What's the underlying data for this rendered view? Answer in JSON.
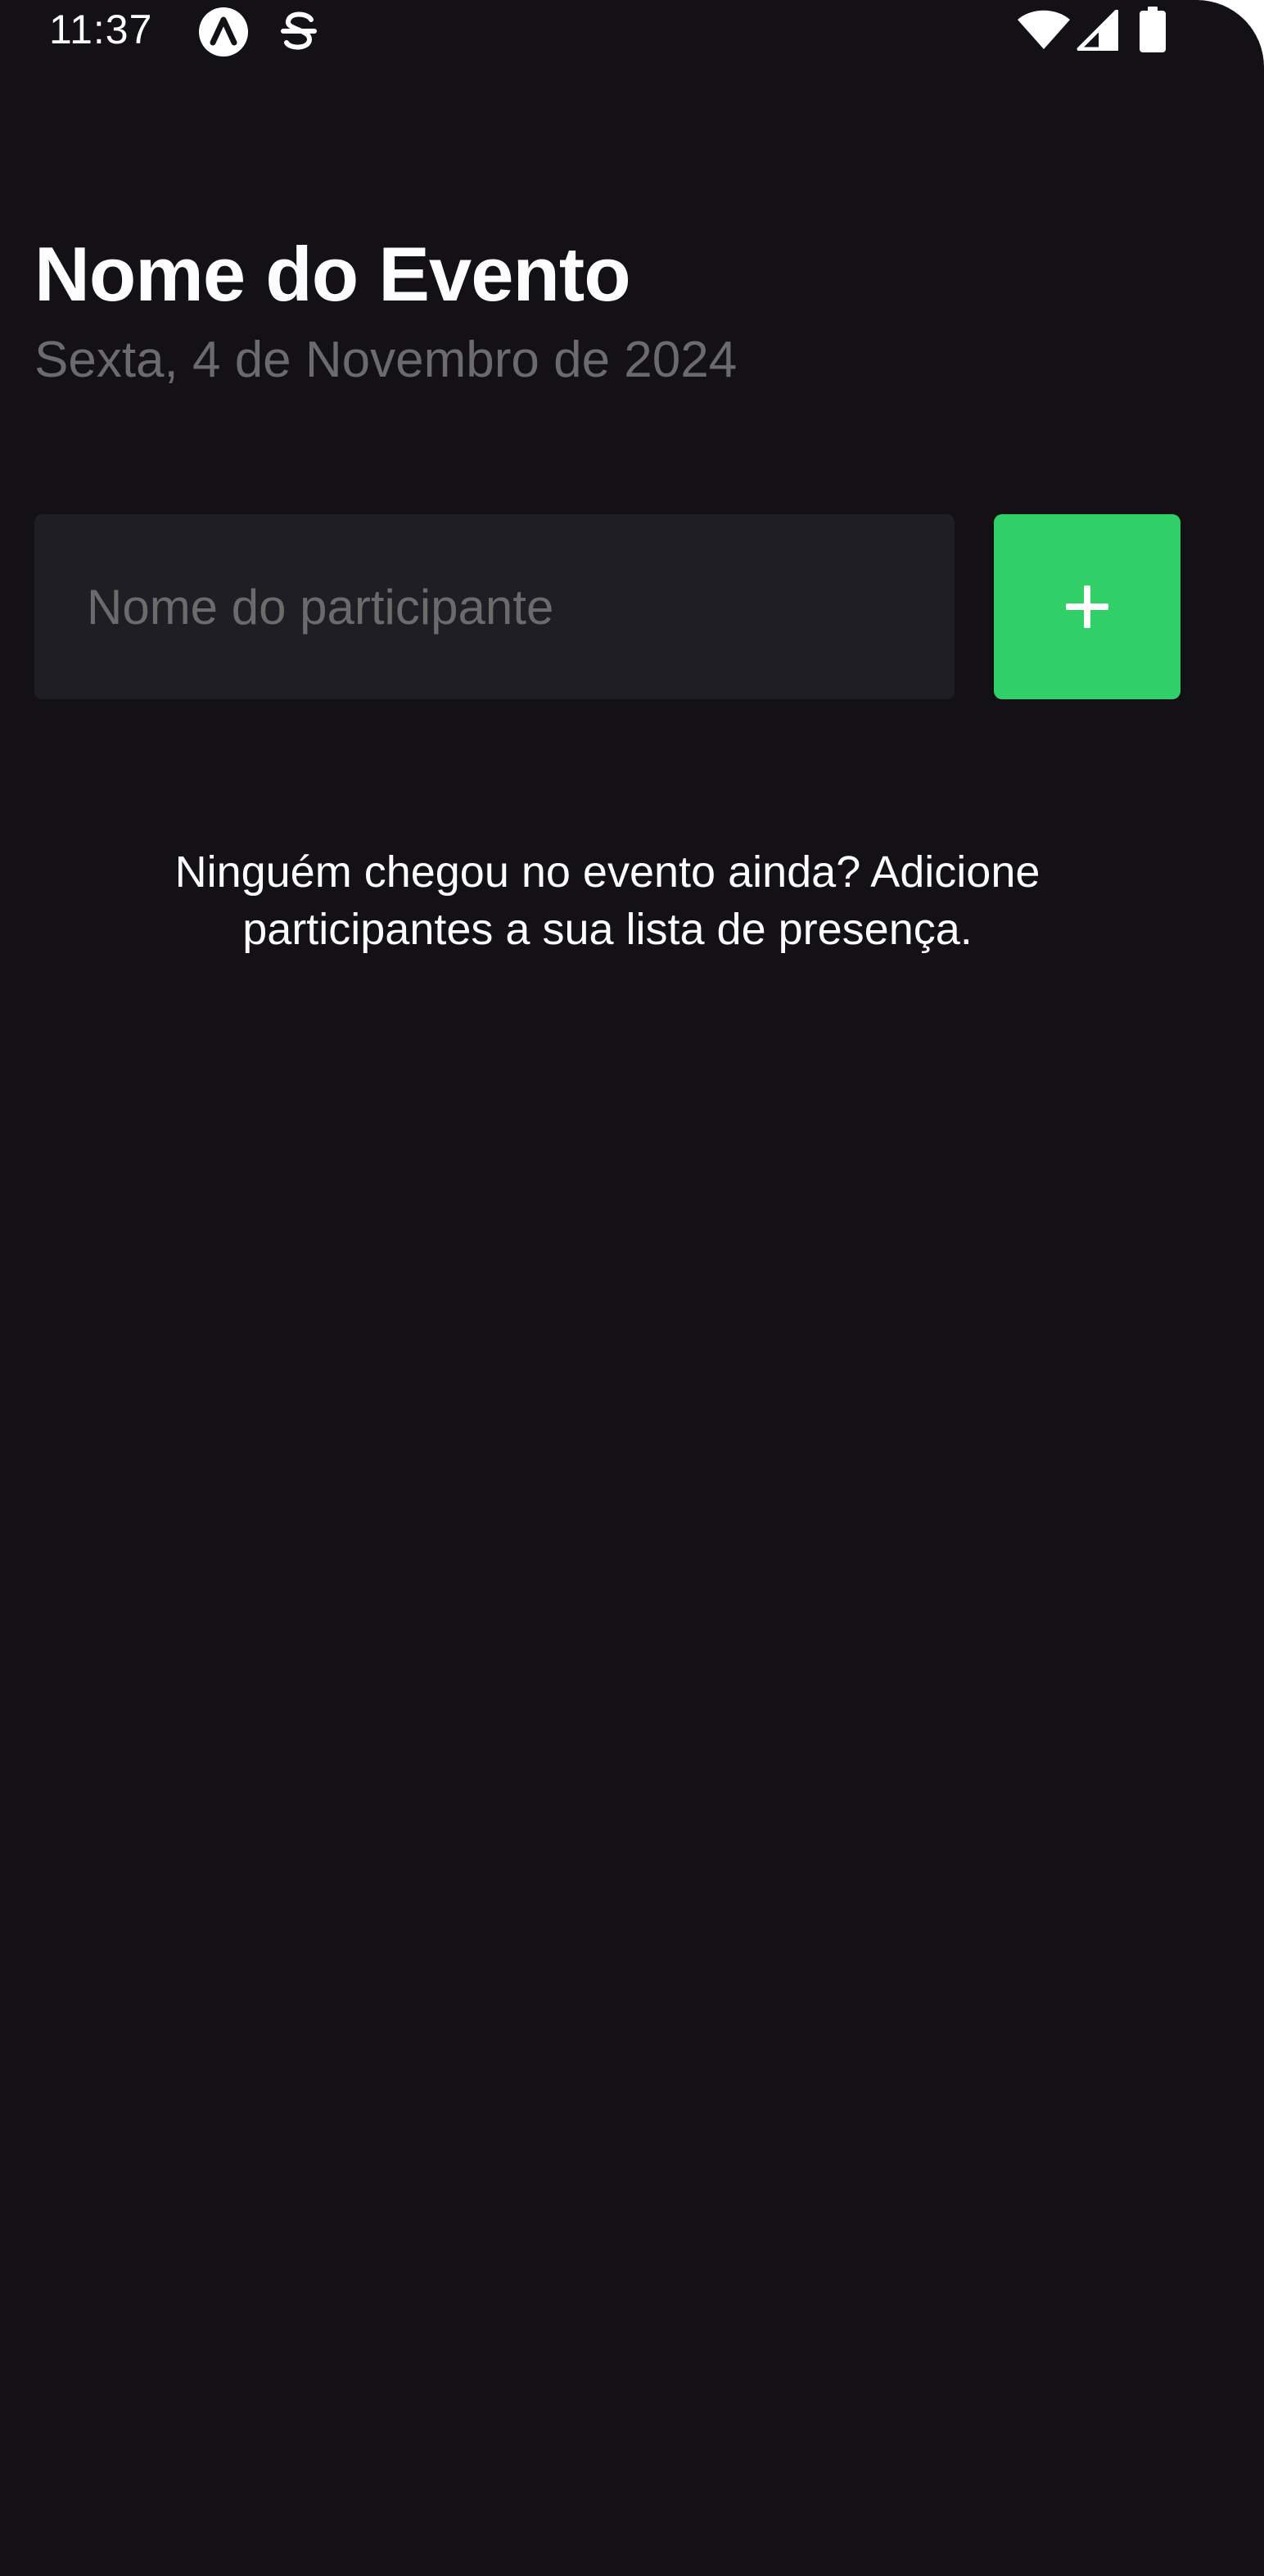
{
  "status_bar": {
    "time": "11:37",
    "icons": [
      "expo-icon",
      "sync-icon",
      "wifi-icon",
      "signal-icon",
      "battery-icon"
    ]
  },
  "header": {
    "title": "Nome do Evento",
    "subtitle": "Sexta, 4 de Novembro de 2024"
  },
  "form": {
    "input_placeholder": "Nome do participante",
    "input_value": "",
    "add_button_icon": "plus-icon"
  },
  "empty_state": {
    "message": "Ninguém chegou no evento ainda? Adicione participantes a sua lista de presença."
  },
  "colors": {
    "background": "#131016",
    "input_background": "#1f1e25",
    "accent": "#31cf67",
    "text_primary": "#fdfcfe",
    "text_secondary": "#6b6b6b"
  }
}
